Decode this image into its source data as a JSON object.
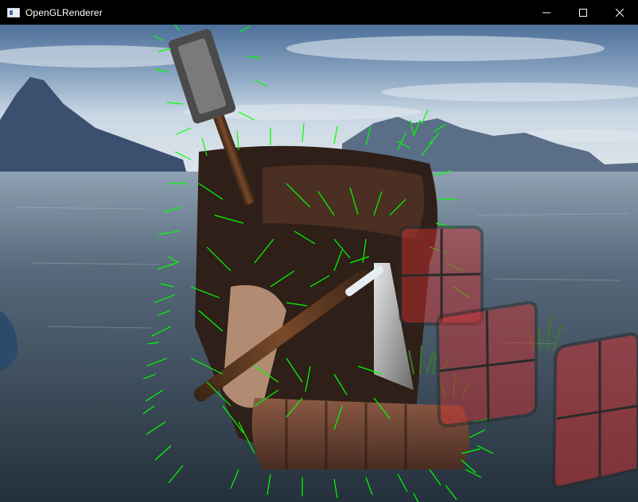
{
  "window": {
    "title": "OpenGLRenderer",
    "controls": [
      "minimize",
      "maximize",
      "close"
    ]
  },
  "icons": {
    "app": "app-window-icon",
    "minimize": "minimize-icon",
    "maximize": "maximize-icon",
    "close": "close-icon"
  },
  "scene": {
    "background": "skybox-sea-mountains",
    "normals_color": "#00ff00",
    "glass_color": "#c83232"
  }
}
